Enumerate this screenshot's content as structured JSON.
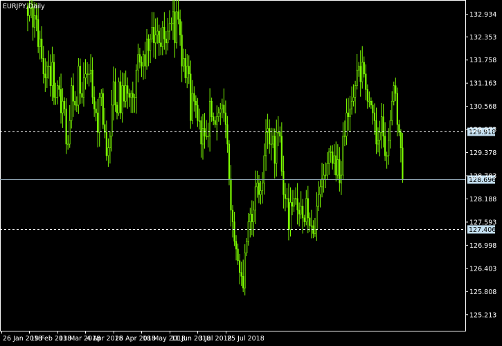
{
  "chart_data": {
    "type": "candlestick",
    "title": "EURJPY,Daily",
    "colors": {
      "background": "#000000",
      "frame": "#ffffff",
      "candle": "#7CFC00",
      "bid_line": "#8fa3b3",
      "level_line": "#ffffff",
      "level_tag": "#c5e1f2",
      "bid_tag": "#c5e1f2"
    },
    "y_axis": {
      "range": [
        124.8,
        133.3
      ],
      "ticks": [
        "132.934",
        "132.353",
        "131.758",
        "131.163",
        "130.568",
        "129.973",
        "129.378",
        "128.783",
        "128.188",
        "127.593",
        "126.998",
        "126.403",
        "125.808",
        "125.213"
      ]
    },
    "x_axis": {
      "ticks": [
        "26 Jan 2018",
        "19 Feb 2018",
        "13 Mar 2018",
        "4 Apr 2018",
        "26 Apr 2018",
        "18 May 2018",
        "11 Jun 2018",
        "3 Jul 2018",
        "25 Jul 2018"
      ],
      "tick_bar_index": [
        0,
        16,
        32,
        48,
        64,
        80,
        96,
        112,
        128
      ]
    },
    "levels": [
      {
        "price": 129.918,
        "label": "129.918",
        "style": "dashed"
      },
      {
        "price": 127.406,
        "label": "127.406",
        "style": "dashed"
      }
    ],
    "bid": {
      "price": 128.696,
      "label": "128.696"
    },
    "closes": [
      132.9,
      133.1,
      133.1,
      132.6,
      132.9,
      132.8,
      132.1,
      132.3,
      131.8,
      131.4,
      131.3,
      131.6,
      131.6,
      131.1,
      131.7,
      130.8,
      130.8,
      131.1,
      131.0,
      130.4,
      130.7,
      130.5,
      129.6,
      129.6,
      130.2,
      131.1,
      130.7,
      130.6,
      130.6,
      131.6,
      130.9,
      130.8,
      131.3,
      131.4,
      131.4,
      131.4,
      131.5,
      130.8,
      130.5,
      130.4,
      129.9,
      130.8,
      130.9,
      130.1,
      129.9,
      129.3,
      129.5,
      129.8,
      130.6,
      131.2,
      130.6,
      130.4,
      131.2,
      130.4,
      131.1,
      130.7,
      131.1,
      130.9,
      130.8,
      130.9,
      130.8,
      130.8,
      131.5,
      131.9,
      131.7,
      131.6,
      131.9,
      131.6,
      132.3,
      132.0,
      132.3,
      132.6,
      132.2,
      132.4,
      132.5,
      132.2,
      132.1,
      132.6,
      132.3,
      132.2,
      132.5,
      132.7,
      132.7,
      133.0,
      132.2,
      133.0,
      132.8,
      132.4,
      131.6,
      131.8,
      131.3,
      131.6,
      131.4,
      130.2,
      130.9,
      130.7,
      130.6,
      130.2,
      130.2,
      129.6,
      130.0,
      129.8,
      129.8,
      129.8,
      130.7,
      130.3,
      130.2,
      130.1,
      130.3,
      130.4,
      130.5,
      130.6,
      130.4,
      130.1,
      129.6,
      128.7,
      127.9,
      127.6,
      127.1,
      126.9,
      126.6,
      126.3,
      126.2,
      125.9,
      126.8,
      127.1,
      127.6,
      127.8,
      127.6,
      127.9,
      128.5,
      128.6,
      128.3,
      128.4,
      128.6,
      129.3,
      129.9,
      130.0,
      129.6,
      129.6,
      129.8,
      129.1,
      129.9,
      129.9,
      129.8,
      128.9,
      128.3,
      128.2,
      128.2,
      127.4,
      128.1,
      128.0,
      128.2,
      128.2,
      127.9,
      127.8,
      128.0,
      127.7,
      127.6,
      128.2,
      127.7,
      127.5,
      127.5,
      127.3,
      127.4,
      128.0,
      128.3,
      128.5,
      128.7,
      128.8,
      128.8,
      129.1,
      129.4,
      129.4,
      129.1,
      129.3,
      128.8,
      129.2,
      128.6,
      128.8,
      129.8,
      129.8,
      130.4,
      130.3,
      130.5,
      130.7,
      130.8,
      131.1,
      131.5,
      131.6,
      131.2,
      131.7,
      131.4,
      131.0,
      130.7,
      130.7,
      130.6,
      130.4,
      130.2,
      129.6,
      129.7,
      129.9,
      130.3,
      129.8,
      129.3,
      129.3,
      129.7,
      130.2,
      130.7,
      131.1,
      130.9,
      130.1,
      129.9,
      129.5,
      128.7
    ]
  }
}
